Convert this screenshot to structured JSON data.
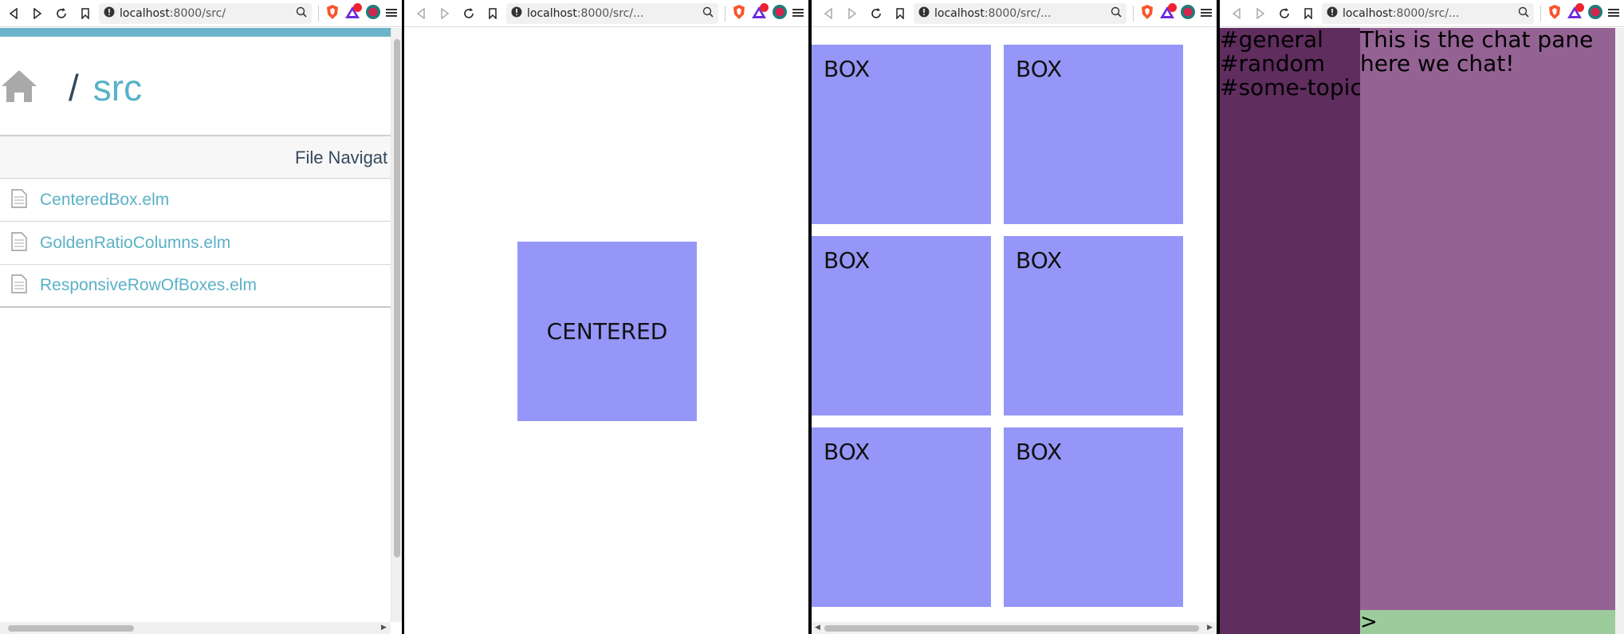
{
  "colors": {
    "accent": "#6cb4ca",
    "link": "#5ab1c7",
    "box": "#9696f8",
    "sidebar": "#5f2d5e",
    "chat_pane": "#946394",
    "input": "#9ccc9c"
  },
  "windows": [
    {
      "url_host": "localhost",
      "url_path": ":8000/src/",
      "breadcrumb_separator": "/",
      "breadcrumb_dir": "src",
      "nav_header": "File Navigat",
      "files": [
        {
          "name": "CenteredBox.elm"
        },
        {
          "name": "GoldenRatioColumns.elm"
        },
        {
          "name": "ResponsiveRowOfBoxes.elm"
        }
      ]
    },
    {
      "url_host": "localhost",
      "url_path": ":8000/src/...",
      "box_label": "CENTERED"
    },
    {
      "url_host": "localhost",
      "url_path": ":8000/src/...",
      "boxes": [
        "BOX",
        "BOX",
        "BOX",
        "BOX",
        "BOX",
        "BOX"
      ]
    },
    {
      "url_host": "localhost",
      "url_path": ":8000/src/...",
      "channels": [
        "#general",
        "#random",
        "#some-topic"
      ],
      "chat_lines": [
        "This is the chat pane",
        "here we chat!"
      ],
      "input_prompt": ">"
    }
  ],
  "toolbar_icons": [
    "back-icon",
    "forward-icon",
    "reload-icon",
    "bookmark-icon",
    "site-info-icon",
    "zoom-icon",
    "brave-shield-icon",
    "brave-rewards-icon",
    "extension-icon",
    "menu-icon"
  ]
}
